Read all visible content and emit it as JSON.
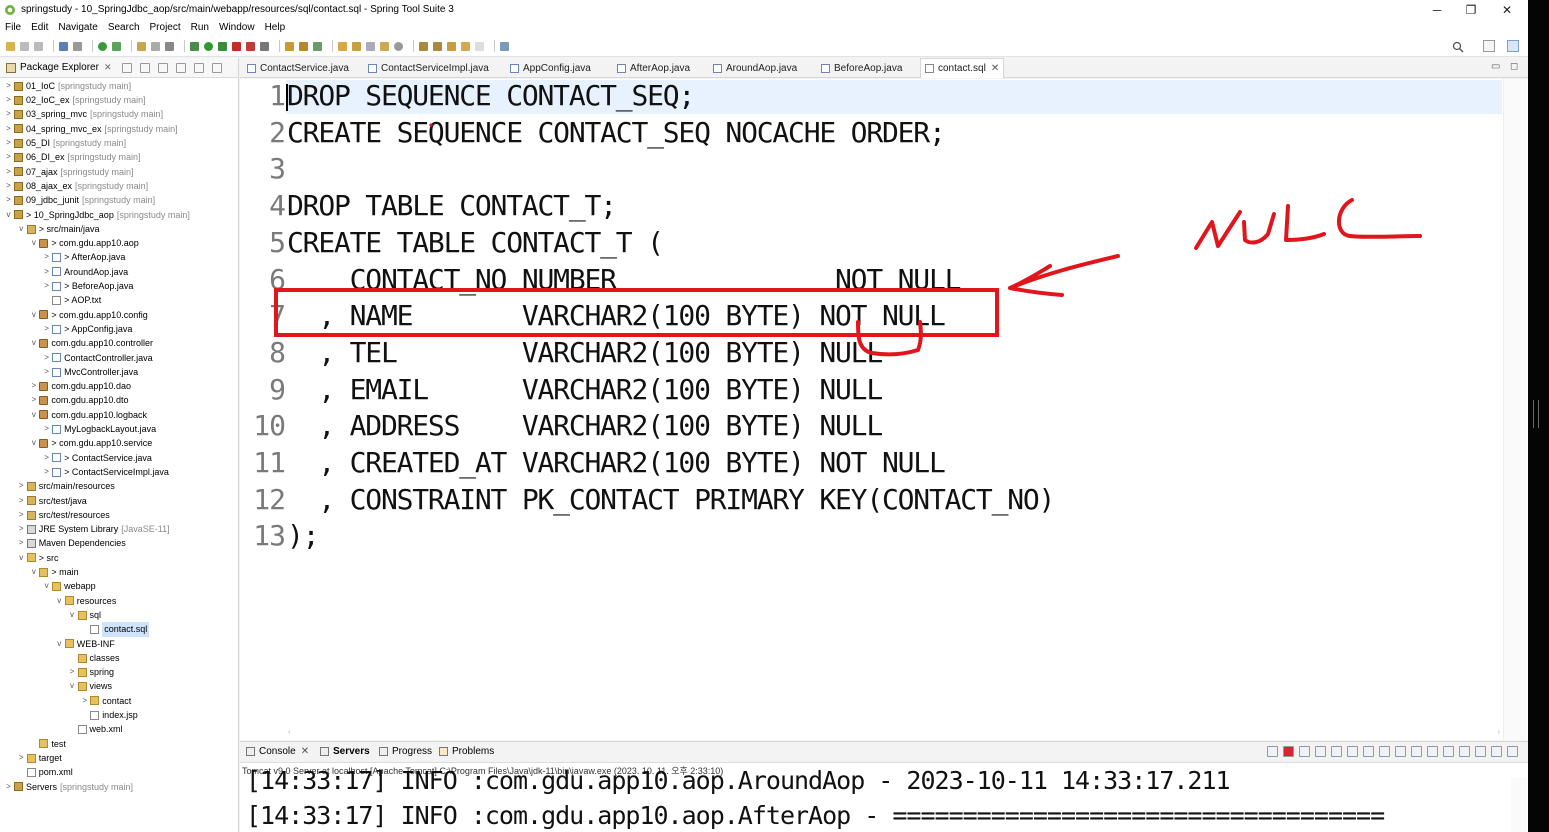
{
  "window": {
    "title": "springstudy - 10_SpringJdbc_aop/src/main/webapp/resources/sql/contact.sql - Spring Tool Suite 3",
    "minimize": "─",
    "maximize": "❐",
    "close": "✕"
  },
  "menu": [
    "File",
    "Edit",
    "Navigate",
    "Search",
    "Project",
    "Run",
    "Window",
    "Help"
  ],
  "package_explorer": {
    "title": "Package Explorer",
    "close": "✕",
    "tree": [
      {
        "t": "01_IoC",
        "d": "[springstudy main]",
        "lvl": 0,
        "tw": ">",
        "ic": "proj"
      },
      {
        "t": "02_IoC_ex",
        "d": "[springstudy main]",
        "lvl": 0,
        "tw": ">",
        "ic": "proj"
      },
      {
        "t": "03_spring_mvc",
        "d": "[springstudy main]",
        "lvl": 0,
        "tw": ">",
        "ic": "proj"
      },
      {
        "t": "04_spring_mvc_ex",
        "d": "[springstudy main]",
        "lvl": 0,
        "tw": ">",
        "ic": "proj"
      },
      {
        "t": "05_DI",
        "d": "[springstudy main]",
        "lvl": 0,
        "tw": ">",
        "ic": "proj"
      },
      {
        "t": "06_DI_ex",
        "d": "[springstudy main]",
        "lvl": 0,
        "tw": ">",
        "ic": "proj"
      },
      {
        "t": "07_ajax",
        "d": "[springstudy main]",
        "lvl": 0,
        "tw": ">",
        "ic": "proj"
      },
      {
        "t": "08_ajax_ex",
        "d": "[springstudy main]",
        "lvl": 0,
        "tw": ">",
        "ic": "proj"
      },
      {
        "t": "09_jdbc_junit",
        "d": "[springstudy main]",
        "lvl": 0,
        "tw": ">",
        "ic": "proj"
      },
      {
        "t": "> 10_SpringJdbc_aop",
        "d": "[springstudy main]",
        "lvl": 0,
        "tw": "v",
        "ic": "proj"
      },
      {
        "t": "> src/main/java",
        "d": "",
        "lvl": 1,
        "tw": "v",
        "ic": "src"
      },
      {
        "t": "> com.gdu.app10.aop",
        "d": "",
        "lvl": 2,
        "tw": "v",
        "ic": "pkg"
      },
      {
        "t": "> AfterAop.java",
        "d": "",
        "lvl": 3,
        "tw": ">",
        "ic": "java"
      },
      {
        "t": "AroundAop.java",
        "d": "",
        "lvl": 3,
        "tw": ">",
        "ic": "java"
      },
      {
        "t": "> BeforeAop.java",
        "d": "",
        "lvl": 3,
        "tw": ">",
        "ic": "java"
      },
      {
        "t": "> AOP.txt",
        "d": "",
        "lvl": 3,
        "tw": "",
        "ic": "file"
      },
      {
        "t": "> com.gdu.app10.config",
        "d": "",
        "lvl": 2,
        "tw": "v",
        "ic": "pkg"
      },
      {
        "t": "> AppConfig.java",
        "d": "",
        "lvl": 3,
        "tw": ">",
        "ic": "java"
      },
      {
        "t": "com.gdu.app10.controller",
        "d": "",
        "lvl": 2,
        "tw": "v",
        "ic": "pkg"
      },
      {
        "t": "ContactController.java",
        "d": "",
        "lvl": 3,
        "tw": ">",
        "ic": "java"
      },
      {
        "t": "MvcController.java",
        "d": "",
        "lvl": 3,
        "tw": ">",
        "ic": "java"
      },
      {
        "t": "com.gdu.app10.dao",
        "d": "",
        "lvl": 2,
        "tw": ">",
        "ic": "pkg"
      },
      {
        "t": "com.gdu.app10.dto",
        "d": "",
        "lvl": 2,
        "tw": ">",
        "ic": "pkg"
      },
      {
        "t": "com.gdu.app10.logback",
        "d": "",
        "lvl": 2,
        "tw": "v",
        "ic": "pkg"
      },
      {
        "t": "MyLogbackLayout.java",
        "d": "",
        "lvl": 3,
        "tw": ">",
        "ic": "java"
      },
      {
        "t": "> com.gdu.app10.service",
        "d": "",
        "lvl": 2,
        "tw": "v",
        "ic": "pkg"
      },
      {
        "t": "> ContactService.java",
        "d": "",
        "lvl": 3,
        "tw": ">",
        "ic": "java"
      },
      {
        "t": "> ContactServiceImpl.java",
        "d": "",
        "lvl": 3,
        "tw": ">",
        "ic": "java"
      },
      {
        "t": "src/main/resources",
        "d": "",
        "lvl": 1,
        "tw": ">",
        "ic": "src"
      },
      {
        "t": "src/test/java",
        "d": "",
        "lvl": 1,
        "tw": ">",
        "ic": "src"
      },
      {
        "t": "src/test/resources",
        "d": "",
        "lvl": 1,
        "tw": ">",
        "ic": "src"
      },
      {
        "t": "JRE System Library",
        "d": "[JavaSE-11]",
        "lvl": 1,
        "tw": ">",
        "ic": "lib"
      },
      {
        "t": "Maven Dependencies",
        "d": "",
        "lvl": 1,
        "tw": ">",
        "ic": "lib"
      },
      {
        "t": "> src",
        "d": "",
        "lvl": 1,
        "tw": "v",
        "ic": "fold"
      },
      {
        "t": "> main",
        "d": "",
        "lvl": 2,
        "tw": "v",
        "ic": "fold"
      },
      {
        "t": "webapp",
        "d": "",
        "lvl": 3,
        "tw": "v",
        "ic": "fold"
      },
      {
        "t": "resources",
        "d": "",
        "lvl": 4,
        "tw": "v",
        "ic": "fold"
      },
      {
        "t": "sql",
        "d": "",
        "lvl": 5,
        "tw": "v",
        "ic": "fold"
      },
      {
        "t": "contact.sql",
        "d": "",
        "lvl": 6,
        "tw": "",
        "ic": "file",
        "sel": true
      },
      {
        "t": "WEB-INF",
        "d": "",
        "lvl": 4,
        "tw": "v",
        "ic": "fold"
      },
      {
        "t": "classes",
        "d": "",
        "lvl": 5,
        "tw": "",
        "ic": "fold"
      },
      {
        "t": "spring",
        "d": "",
        "lvl": 5,
        "tw": ">",
        "ic": "fold"
      },
      {
        "t": "views",
        "d": "",
        "lvl": 5,
        "tw": "v",
        "ic": "fold"
      },
      {
        "t": "contact",
        "d": "",
        "lvl": 6,
        "tw": ">",
        "ic": "fold"
      },
      {
        "t": "index.jsp",
        "d": "",
        "lvl": 6,
        "tw": "",
        "ic": "file"
      },
      {
        "t": "web.xml",
        "d": "",
        "lvl": 5,
        "tw": "",
        "ic": "file"
      },
      {
        "t": "test",
        "d": "",
        "lvl": 2,
        "tw": "",
        "ic": "fold"
      },
      {
        "t": "target",
        "d": "",
        "lvl": 1,
        "tw": ">",
        "ic": "fold"
      },
      {
        "t": "pom.xml",
        "d": "",
        "lvl": 1,
        "tw": "",
        "ic": "file"
      },
      {
        "t": "Servers",
        "d": "[springstudy main]",
        "lvl": 0,
        "tw": ">",
        "ic": "proj"
      }
    ]
  },
  "editor_tabs": [
    {
      "label": "ContactService.java",
      "active": false
    },
    {
      "label": "ContactServiceImpl.java",
      "active": false
    },
    {
      "label": "AppConfig.java",
      "active": false
    },
    {
      "label": "AfterAop.java",
      "active": false
    },
    {
      "label": "AroundAop.java",
      "active": false
    },
    {
      "label": "BeforeAop.java",
      "active": false
    },
    {
      "label": "contact.sql",
      "active": true
    }
  ],
  "tab_close": "✕",
  "editor": {
    "lines": [
      {
        "n": "1",
        "code": "DROP SEQUENCE CONTACT_SEQ;"
      },
      {
        "n": "2",
        "code": "CREATE SEQUENCE CONTACT_SEQ NOCACHE ORDER;"
      },
      {
        "n": "3",
        "code": ""
      },
      {
        "n": "4",
        "code": "DROP TABLE CONTACT_T;"
      },
      {
        "n": "5",
        "code": "CREATE TABLE CONTACT_T ("
      },
      {
        "n": "6",
        "code": "    CONTACT_NO NUMBER              NOT NULL"
      },
      {
        "n": "7",
        "code": "  , NAME       VARCHAR2(100 BYTE) NOT NULL"
      },
      {
        "n": "8",
        "code": "  , TEL        VARCHAR2(100 BYTE) NULL"
      },
      {
        "n": "9",
        "code": "  , EMAIL      VARCHAR2(100 BYTE) NULL"
      },
      {
        "n": "10",
        "code": "  , ADDRESS    VARCHAR2(100 BYTE) NULL"
      },
      {
        "n": "11",
        "code": "  , CREATED_AT VARCHAR2(100 BYTE) NOT NULL"
      },
      {
        "n": "12",
        "code": "  , CONSTRAINT PK_CONTACT PRIMARY KEY(CONTACT_NO)"
      },
      {
        "n": "13",
        "code": ");"
      }
    ]
  },
  "annotation": {
    "handwritten_text": "NULL",
    "color": "#e0161c"
  },
  "bottom_panel": {
    "tabs": [
      "Console",
      "Servers",
      "Progress",
      "Problems"
    ],
    "tab_close": "✕",
    "server_line": "Tomcat v9.0 Server at localhost [Apache Tomcat] C:\\Program Files\\Java\\jdk-11\\bin\\javaw.exe  (2023. 10. 11. 오후 2:33:10)",
    "console_lines": [
      "[14:33:17] INFO :com.gdu.app10.aop.AroundAop - 2023-10-11 14:33:17.211",
      "[14:33:17] INFO :com.gdu.app10.aop.AfterAop - ==================================="
    ]
  }
}
